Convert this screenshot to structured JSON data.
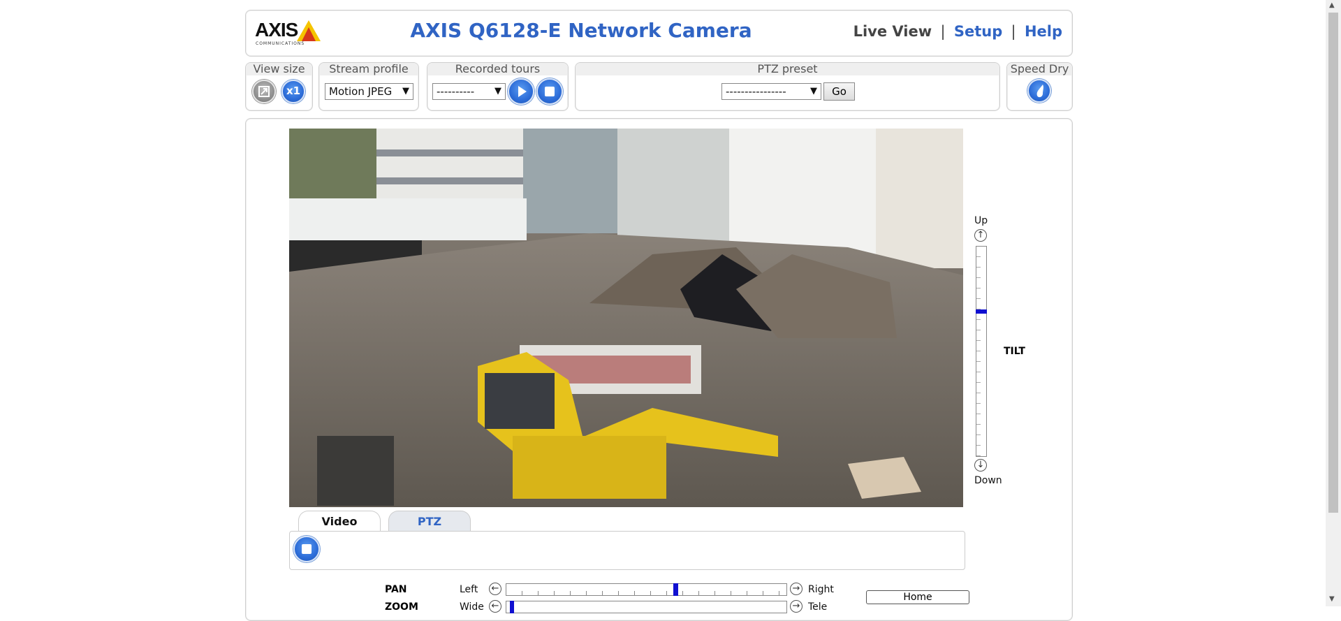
{
  "header": {
    "logo_text": "AXIS",
    "logo_sub": "COMMUNICATIONS",
    "camera_title": "AXIS Q6128-E Network Camera",
    "nav": {
      "live_view": "Live View",
      "sep": "|",
      "setup": "Setup",
      "help": "Help"
    }
  },
  "toolbar": {
    "view_size": {
      "title": "View size",
      "zoom_label": "x1"
    },
    "stream_profile": {
      "title": "Stream profile",
      "value": "Motion JPEG"
    },
    "recorded_tours": {
      "title": "Recorded tours",
      "value": "----------"
    },
    "ptz_preset": {
      "title": "PTZ preset",
      "value": "----------------",
      "go": "Go"
    },
    "speed_dry": {
      "title": "Speed Dry"
    }
  },
  "tilt": {
    "up": "Up",
    "down": "Down",
    "label": "TILT",
    "level_percent": 30
  },
  "tabs": {
    "video": "Video",
    "ptz": "PTZ"
  },
  "controls": {
    "pan": {
      "label": "PAN",
      "left": "Left",
      "right": "Right",
      "position_percent": 57
    },
    "zoom": {
      "label": "ZOOM",
      "wide": "Wide",
      "tele": "Tele",
      "position_percent": 1
    },
    "home": "Home"
  },
  "colors": {
    "accent_blue": "#3064c4",
    "title_dark": "#444444"
  }
}
